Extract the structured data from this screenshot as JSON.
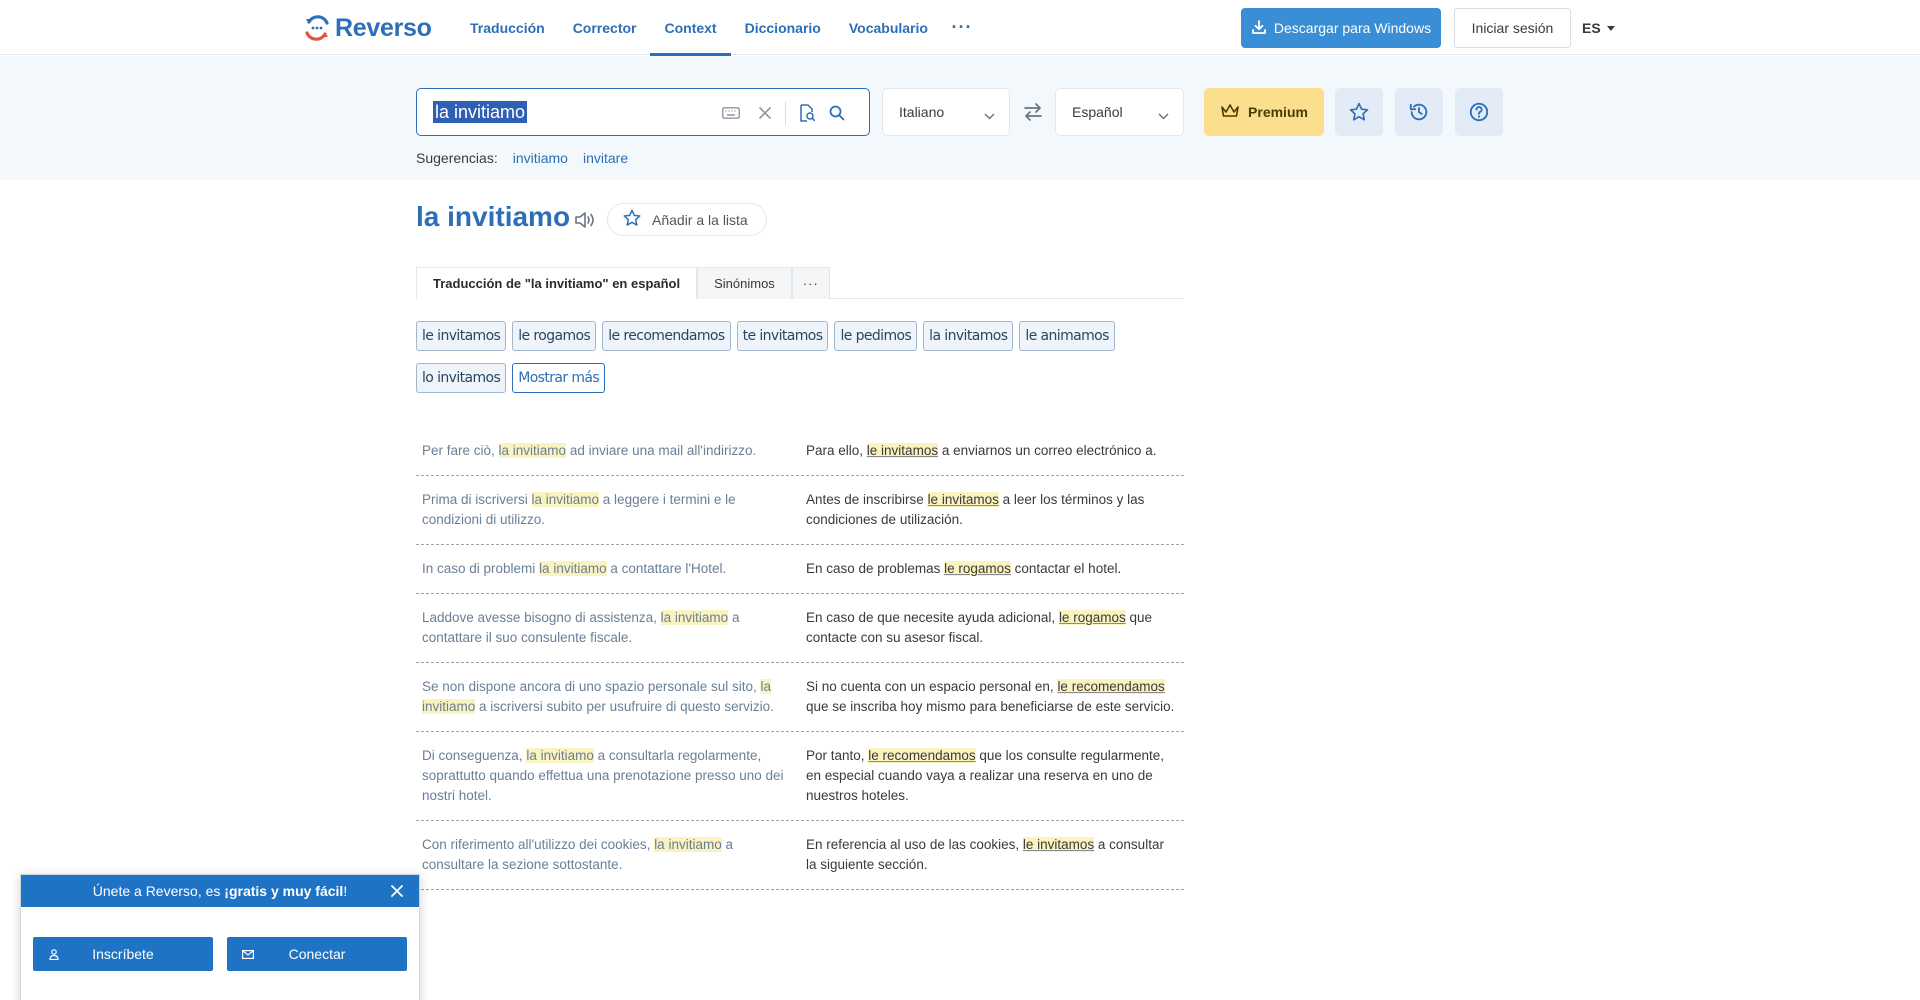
{
  "nav": {
    "logo_text": "Reverso",
    "links": [
      {
        "label": "Traducción",
        "active": false
      },
      {
        "label": "Corrector",
        "active": false
      },
      {
        "label": "Context",
        "active": true
      },
      {
        "label": "Diccionario",
        "active": false
      },
      {
        "label": "Vocabulario",
        "active": false
      }
    ],
    "more_label": "···",
    "download_label": "Descargar para Windows",
    "login_label": "Iniciar sesión",
    "ui_language": "ES"
  },
  "search": {
    "query": "la invitiamo",
    "source_language": "Italiano",
    "target_language": "Español",
    "premium_label": "Premium",
    "suggestions_label": "Sugerencias:",
    "suggestions": [
      "invitiamo",
      "invitare"
    ]
  },
  "heading": {
    "title": "la invitiamo",
    "add_to_list_label": "Añadir a la lista"
  },
  "tabs": [
    {
      "label": "Traducción de \"la invitiamo\" en español",
      "active": true
    },
    {
      "label": "Sinónimos",
      "active": false
    },
    {
      "label": "···",
      "active": false
    }
  ],
  "translations": [
    "le invitamos",
    "le rogamos",
    "le recomendamos",
    "te invitamos",
    "le pedimos",
    "la invitamos",
    "le animamos",
    "lo invitamos"
  ],
  "show_more_label": "Mostrar más",
  "examples": [
    {
      "src": [
        {
          "t": "Per fare ciò, "
        },
        {
          "t": "la invitiamo",
          "hl": true
        },
        {
          "t": " ad inviare una mail all'indirizzo."
        }
      ],
      "trg": [
        {
          "t": "Para ello, "
        },
        {
          "t": "le invitamos",
          "hl": true
        },
        {
          "t": " a enviarnos un correo electrónico a."
        }
      ]
    },
    {
      "src": [
        {
          "t": "Prima di iscriversi "
        },
        {
          "t": "la invitiamo",
          "hl": true
        },
        {
          "t": " a leggere i termini e le condizioni di utilizzo."
        }
      ],
      "trg": [
        {
          "t": "Antes de inscribirse "
        },
        {
          "t": "le invitamos",
          "hl": true
        },
        {
          "t": " a leer los términos y las condiciones de utilización."
        }
      ]
    },
    {
      "src": [
        {
          "t": "In caso di problemi "
        },
        {
          "t": "la invitiamo",
          "hl": true
        },
        {
          "t": " a contattare l'Hotel."
        }
      ],
      "trg": [
        {
          "t": "En caso de problemas "
        },
        {
          "t": "le rogamos",
          "hl": true
        },
        {
          "t": " contactar el hotel."
        }
      ]
    },
    {
      "src": [
        {
          "t": "Laddove avesse bisogno di assistenza, "
        },
        {
          "t": "la invitiamo",
          "hl": true
        },
        {
          "t": " a contattare il suo consulente fiscale."
        }
      ],
      "trg": [
        {
          "t": "En caso de que necesite ayuda adicional, "
        },
        {
          "t": "le rogamos",
          "hl": true
        },
        {
          "t": " que contacte con su asesor fiscal."
        }
      ]
    },
    {
      "src": [
        {
          "t": "Se non dispone ancora di uno spazio personale sul sito, "
        },
        {
          "t": "la invitiamo",
          "hl": true
        },
        {
          "t": " a iscriversi subito per usufruire di questo servizio."
        }
      ],
      "trg": [
        {
          "t": "Si no cuenta con un espacio personal en, "
        },
        {
          "t": "le recomendamos",
          "hl": true
        },
        {
          "t": " que se inscriba hoy mismo para beneficiarse de este servicio."
        }
      ]
    },
    {
      "src": [
        {
          "t": "Di conseguenza, "
        },
        {
          "t": "la invitiamo",
          "hl": true
        },
        {
          "t": " a consultarla regolarmente, soprattutto quando effettua una prenotazione presso uno dei nostri hotel."
        }
      ],
      "trg": [
        {
          "t": "Por tanto, "
        },
        {
          "t": "le recomendamos",
          "hl": true
        },
        {
          "t": " que los consulte regularmente, en especial cuando vaya a realizar una reserva en uno de nuestros hoteles."
        }
      ]
    },
    {
      "src": [
        {
          "t": "Con riferimento all'utilizzo dei cookies, "
        },
        {
          "t": "la invitiamo",
          "hl": true
        },
        {
          "t": " a consultare la sezione sottostante."
        }
      ],
      "trg": [
        {
          "t": "En referencia al uso de las cookies, "
        },
        {
          "t": "le invitamos",
          "hl": true
        },
        {
          "t": " a consultar la siguiente sección."
        }
      ]
    }
  ],
  "popup": {
    "title_prefix": "Únete a Reverso, es ",
    "title_bold": "¡gratis y muy fácil",
    "title_suffix": "!",
    "signup_label": "Inscríbete",
    "connect_label": "Conectar"
  },
  "colors": {
    "brand": "#2d6fb7",
    "download": "#3a8ed6",
    "premium": "#fcdf8e",
    "highlight": "#fbf3bf",
    "popup": "#1f73c4"
  }
}
